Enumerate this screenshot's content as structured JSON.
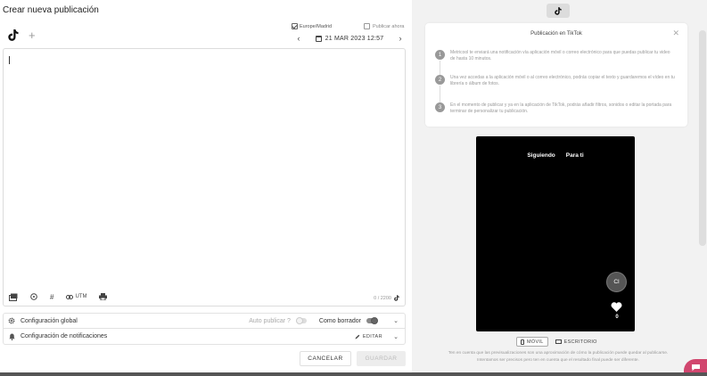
{
  "title": "Crear nueva publicación",
  "network": {
    "icon": "tiktok-icon",
    "add_icon": "plus-icon"
  },
  "schedule": {
    "timezone": "Europe/Madrid",
    "publish_now_label": "Publicar ahora",
    "date_label": "21 MAR 2023 12:57"
  },
  "editor": {
    "text": "",
    "char_counter": "0 / 2200",
    "toolbar": {
      "media_icon": "media-icon",
      "emoji_icon": "emoji-icon",
      "hashtag_label": "#",
      "utm_label": "UTM",
      "print_icon": "print-icon"
    }
  },
  "options": {
    "global_config_label": "Configuración global",
    "auto_publish_label": "Auto publicar ?",
    "as_draft_label": "Como borrador",
    "notifications_label": "Configuración de notificaciones",
    "edit_label": "EDITAR"
  },
  "actions": {
    "cancel_label": "CANCELAR",
    "save_label": "GUARDAR"
  },
  "preview": {
    "card_title": "Publicación en TikTok",
    "steps": [
      {
        "num": "1",
        "text": "Metricool te enviará una notificación vía aplicación móvil o correo electrónico para que puedas publicar tu video de hasta 10 minutos."
      },
      {
        "num": "2",
        "text": "Una vez accedas a la aplicación móvil o al correo electrónico, podrás copiar el texto y guardaremos el vídeo en tu librería o álbum de fotos."
      },
      {
        "num": "3",
        "text": "En el momento de publicar y ya en la aplicación de TikTok, podrás añadir filtros, sonidos o editar la portada para terminar de personalizar tu publicación."
      }
    ],
    "phone_tab_following": "Siguiendo",
    "phone_tab_foryou": "Para ti",
    "avatar_initials": "Cl",
    "likes": "0",
    "view_mobile_label": "MÓVIL",
    "view_desktop_label": "ESCRITORIO",
    "disclaimer_line1": "Ten en cuenta que las previsualizaciones son una aproximación de cómo la publicación puede quedar al publicarse.",
    "disclaimer_line2": "Intentamos ser precisos pero ten en cuenta que el resultado final puede ser diferente."
  },
  "colors": {
    "chat_accent": "#d1466e",
    "phone_bg": "#000000",
    "right_bg": "#f2f2f2"
  }
}
